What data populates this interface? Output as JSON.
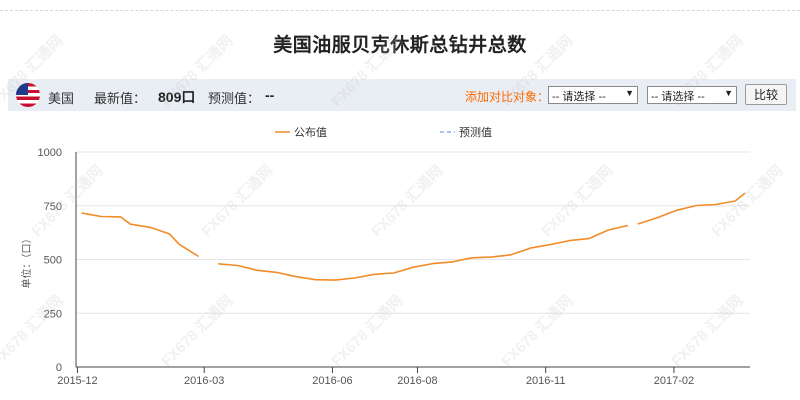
{
  "title": "美国油服贝克休斯总钻井总数",
  "infobar": {
    "country": "美国",
    "latest_label": "最新值：",
    "latest_value": "809口",
    "forecast_label": "预测值：",
    "forecast_value": "--",
    "compare_label": "添加对比对象：",
    "select1": "-- 请选择 --",
    "select2": "-- 请选择 --",
    "compare_button": "比较",
    "flag_icon": "us-flag-icon"
  },
  "watermark": "FX678 汇通网",
  "colors": {
    "published": "#f28c28",
    "forecast": "#8fb2d8",
    "accent": "#ff6a00",
    "bar": "#e9edf4"
  },
  "chart_data": {
    "type": "line",
    "ylabel": "单位：（口）",
    "ylim": [
      0,
      1000
    ],
    "yticks": [
      0,
      250,
      500,
      750,
      1000
    ],
    "xlim": [
      "2015-11-30",
      "2017-03-24"
    ],
    "xticks": [
      "2015-12",
      "2016-03",
      "2016-06",
      "2016-08",
      "2016-11",
      "2017-02"
    ],
    "grid": "horizontal",
    "legend": "top-center",
    "series": [
      {
        "name": "公布值",
        "segments": [
          [
            [
              "2015-12-04",
              716
            ],
            [
              "2015-12-18",
              700
            ],
            [
              "2016-01-01",
              698
            ],
            [
              "2016-01-08",
              664
            ],
            [
              "2016-01-22",
              650
            ],
            [
              "2016-02-05",
              619
            ],
            [
              "2016-02-12",
              571
            ],
            [
              "2016-02-26",
              514
            ]
          ],
          [
            [
              "2016-03-11",
              480
            ],
            [
              "2016-03-25",
              472
            ],
            [
              "2016-04-08",
              450
            ],
            [
              "2016-04-22",
              440
            ],
            [
              "2016-05-06",
              420
            ],
            [
              "2016-05-20",
              406
            ],
            [
              "2016-06-03",
              404
            ],
            [
              "2016-06-17",
              414
            ],
            [
              "2016-07-01",
              431
            ],
            [
              "2016-07-15",
              437
            ],
            [
              "2016-07-29",
              464
            ],
            [
              "2016-08-12",
              481
            ],
            [
              "2016-08-26",
              489
            ],
            [
              "2016-09-09",
              508
            ],
            [
              "2016-09-23",
              511
            ],
            [
              "2016-10-07",
              522
            ],
            [
              "2016-10-21",
              553
            ],
            [
              "2016-11-04",
              569
            ],
            [
              "2016-11-18",
              588
            ],
            [
              "2016-12-02",
              597
            ],
            [
              "2016-12-16",
              637
            ],
            [
              "2016-12-30",
              658
            ]
          ],
          [
            [
              "2017-01-06",
              665
            ],
            [
              "2017-01-20",
              694
            ],
            [
              "2017-02-03",
              729
            ],
            [
              "2017-02-17",
              751
            ],
            [
              "2017-03-03",
              756
            ],
            [
              "2017-03-17",
              772
            ],
            [
              "2017-03-24",
              809
            ]
          ]
        ]
      },
      {
        "name": "预测值",
        "segments": []
      }
    ]
  }
}
